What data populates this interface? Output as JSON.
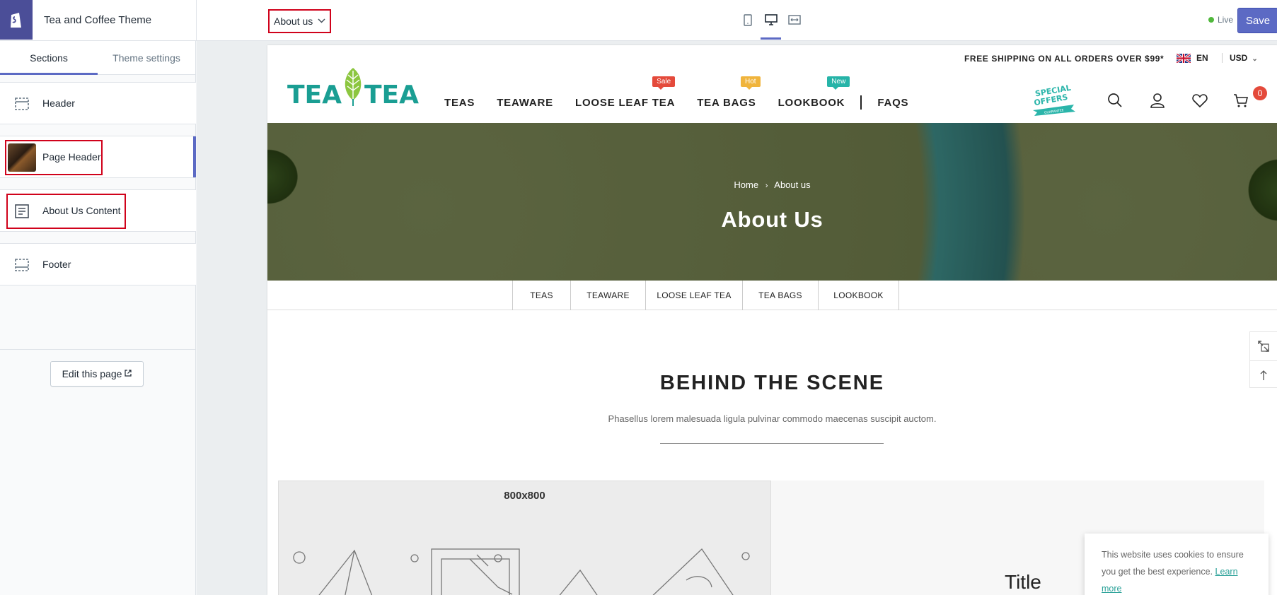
{
  "editor": {
    "theme_name": "Tea and Coffee Theme",
    "page_selector": "About us",
    "live_label": "Live",
    "save_label": "Save",
    "colors": {
      "accent": "#5c6ac4",
      "highlight": "#d0021b",
      "live_dot": "#50b83c"
    }
  },
  "sidebar": {
    "tabs": [
      {
        "label": "Sections",
        "active": true
      },
      {
        "label": "Theme settings",
        "active": false
      }
    ],
    "sections": [
      {
        "label": "Header",
        "icon": "header-layout-icon"
      },
      {
        "label": "Page Header",
        "icon": "page-header-thumbnail",
        "selected": true
      },
      {
        "label": "About Us Content",
        "icon": "text-block-icon"
      },
      {
        "label": "Footer",
        "icon": "footer-layout-icon"
      }
    ],
    "edit_page_label": "Edit this page"
  },
  "store": {
    "shipping_note": "FREE SHIPPING ON ALL ORDERS OVER $99*",
    "language": "EN",
    "currency": "USD",
    "brand_left": "TEA",
    "brand_right": "TEA",
    "nav": [
      {
        "label": "TEAS"
      },
      {
        "label": "TEAWARE"
      },
      {
        "label": "LOOSE LEAF TEA",
        "badge": "Sale",
        "badge_color": "#e44a3b"
      },
      {
        "label": "TEA BAGS",
        "badge": "Hot",
        "badge_color": "#f0b43c"
      },
      {
        "label": "LOOKBOOK",
        "badge": "New",
        "badge_color": "#26b4a8"
      },
      {
        "label": "FAQS"
      }
    ],
    "special_offers": {
      "line1": "SPECIAL",
      "line2": "OFFERS",
      "ribbon": "GUARANTEE"
    },
    "cart_count": "0"
  },
  "hero": {
    "breadcrumb_home": "Home",
    "breadcrumb_current": "About us",
    "title": "About Us"
  },
  "sub_menu": [
    "TEAS",
    "TEAWARE",
    "LOOSE LEAF TEA",
    "TEA BAGS",
    "LOOKBOOK"
  ],
  "content": {
    "title": "BEHIND THE SCENE",
    "subtitle": "Phasellus lorem malesuada ligula pulvinar commodo maecenas suscipit auctom.",
    "placeholder_label": "800x800",
    "panel_title": "Title"
  },
  "cookie": {
    "text": "This website uses cookies to ensure you get the best experience.",
    "link": "Learn more"
  }
}
